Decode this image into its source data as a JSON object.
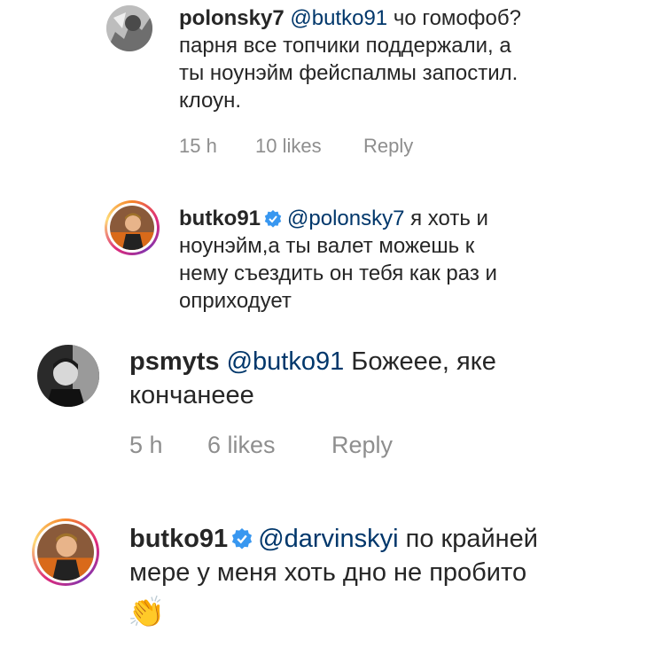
{
  "comments": [
    {
      "username": "polonsky7",
      "mention": "@butko91",
      "text_line1": " чо гомофоб?",
      "text_lines": [
        "парня все топчики поддержали, а",
        "ты ноунэйм фейспалмы запостил.",
        "клоун."
      ],
      "time": "15 h",
      "likes": "10 likes",
      "reply": "Reply"
    },
    {
      "username": "butko91",
      "mention": "@polonsky7",
      "text_line1": " я хоть и",
      "text_lines": [
        "ноунэйм,а ты валет можешь к",
        "нему съездить он тебя как раз и",
        "оприходует"
      ]
    },
    {
      "username": "psmyts",
      "mention": "@butko91",
      "text_line1": " Божеее, яке",
      "text_lines": [
        "кончанеее"
      ],
      "time": "5 h",
      "likes": "6 likes",
      "reply": "Reply"
    },
    {
      "username": "butko91",
      "mention": "@darvinskyi",
      "text_line1": " по крайней",
      "text_lines": [
        "мере у меня хоть дно не пробито"
      ],
      "emoji": "👏"
    }
  ],
  "icons": {
    "verified": "verified-badge-icon",
    "emoji": "clapping-hands-icon"
  },
  "colors": {
    "mention": "#00376b",
    "verified": "#3897f0",
    "meta": "#8e8e8e"
  }
}
